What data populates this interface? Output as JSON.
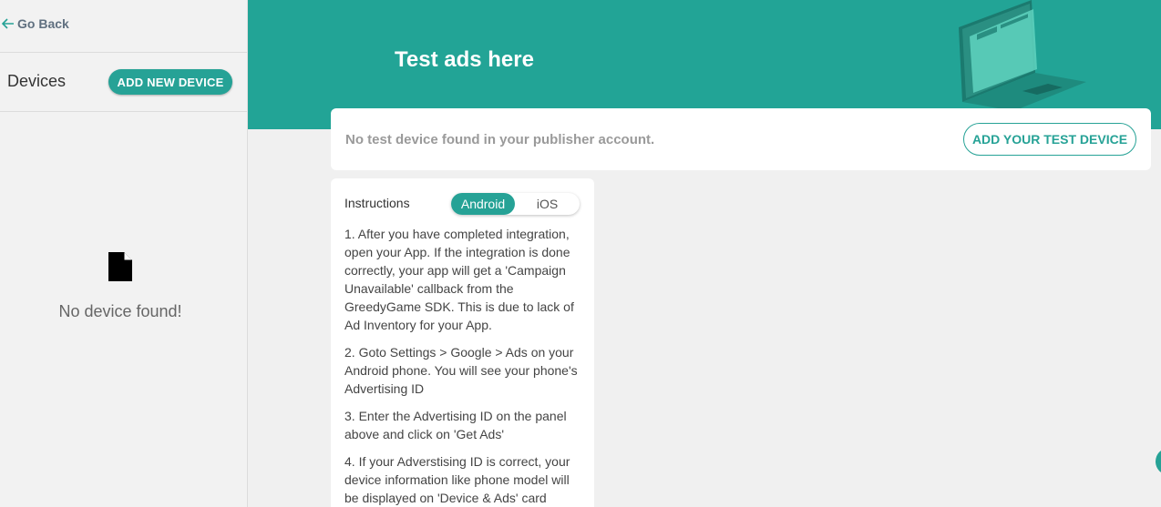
{
  "sidebar": {
    "go_back": "Go Back",
    "title": "Devices",
    "add_button": "ADD NEW DEVICE",
    "empty_icon": "file-icon",
    "empty_text": "No device found!"
  },
  "banner": {
    "title": "Test ads here",
    "illustration": "laptop-illustration"
  },
  "notice": {
    "text": "No test device found in your publisher account.",
    "button": "ADD YOUR TEST DEVICE"
  },
  "instructions": {
    "title": "Instructions",
    "tabs": [
      "Android",
      "iOS"
    ],
    "selected_tab": "Android",
    "steps": [
      "1. After you have completed integration, open your App. If the integration is done correctly, your app will get a 'Campaign Unavailable' callback from the GreedyGame SDK. This is due to lack of Ad Inventory for your App.",
      "2. Goto Settings > Google > Ads on your Android phone. You will see your phone's Advertising ID",
      "3. Enter the Advertising ID on the panel above and click on 'Get Ads'",
      "4. If your Adverstising ID is correct, your device information like phone model will be displayed on 'Device & Ads' card"
    ]
  },
  "colors": {
    "accent": "#26a296",
    "banner": "#22a496"
  }
}
